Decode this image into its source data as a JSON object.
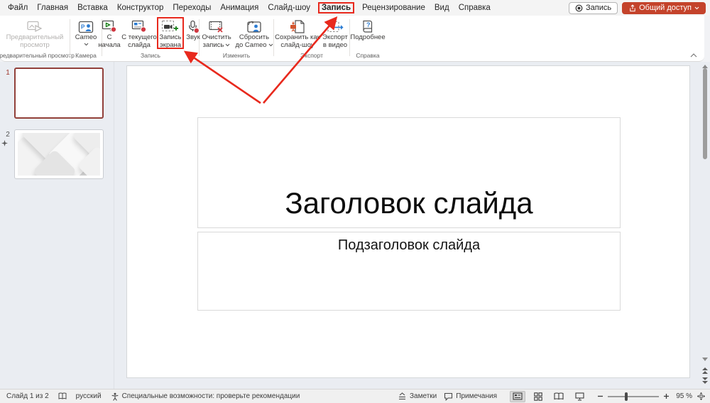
{
  "colors": {
    "accent": "#c4432b",
    "annotation": "#e8291d",
    "record_red": "#cf3741",
    "green": "#107c10",
    "blue": "#2b7cd3"
  },
  "menubar": {
    "items": [
      "Файл",
      "Главная",
      "Вставка",
      "Конструктор",
      "Переходы",
      "Анимация",
      "Слайд-шоу",
      "Запись",
      "Рецензирование",
      "Вид",
      "Справка"
    ],
    "active_item": "Запись",
    "record_button": "Запись",
    "share_button": "Общий доступ"
  },
  "ribbon": {
    "preview": "Предварительный просмотр",
    "preview_group": "Предварительный просмотр",
    "cameo": "Cameo",
    "camera_group": "Камера",
    "from_start": "С начала",
    "from_current": "С текущего слайда",
    "screen_record": "Запись экрана",
    "audio": "Звук",
    "record_group": "Запись",
    "clear_recording": "Очистить запись",
    "reset_cameo": "Сбросить до Cameo",
    "edit_group": "Изменить",
    "save_as_show": "Сохранить как слайд-шоу",
    "export_video": "Экспорт в видео",
    "export_group": "Экспорт",
    "more": "Подробнее",
    "help_group": "Справка"
  },
  "slides_panel": {
    "slide1_number": "1",
    "slide2_number": "2"
  },
  "slide": {
    "title": "Заголовок слайда",
    "subtitle": "Подзаголовок слайда"
  },
  "statusbar": {
    "slide_counter": "Слайд 1 из 2",
    "language": "русский",
    "accessibility": "Специальные возможности: проверьте рекомендации",
    "notes": "Заметки",
    "comments": "Примечания",
    "zoom_level": "95 %"
  },
  "icons": {
    "record": "record-circle",
    "share": "share-arrow",
    "screen_record": "camera-plus-dashed",
    "audio": "microphone-record",
    "views": [
      "normal-view",
      "slide-sorter",
      "reading-view",
      "slideshow"
    ]
  }
}
